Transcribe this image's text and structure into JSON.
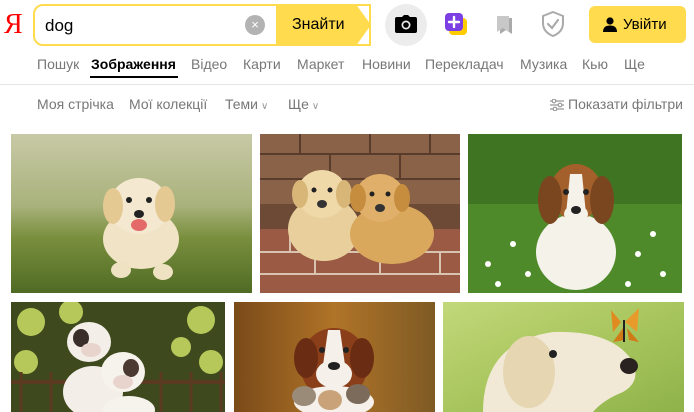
{
  "header": {
    "logo": "Я",
    "search_value": "dog",
    "clear_icon": "×",
    "search_button": "Знайти",
    "login_button": "Увійти"
  },
  "services": [
    "Пошук",
    "Зображення",
    "Відео",
    "Карти",
    "Маркет",
    "Новини",
    "Перекладач",
    "Музика",
    "Кью",
    "Ще"
  ],
  "active_service": "Зображення",
  "subnav": {
    "feed": "Моя стрічка",
    "collections": "Мої колекції",
    "themes": "Теми",
    "more": "Ще",
    "filters": "Показати фільтри"
  },
  "colors": {
    "accent": "#ffdb4d",
    "logo": "#ff0000",
    "collections_icon": "#7b3fe4"
  },
  "images": [
    {
      "subject": "golden retriever puppy running on grass"
    },
    {
      "subject": "two labrador puppies lying on brick ledge"
    },
    {
      "subject": "beagle puppy sitting in grass with flowers"
    },
    {
      "subject": "two bulldog puppies in front of greenery"
    },
    {
      "subject": "saint bernard puppy with kittens"
    },
    {
      "subject": "retriever with butterfly on nose"
    }
  ]
}
